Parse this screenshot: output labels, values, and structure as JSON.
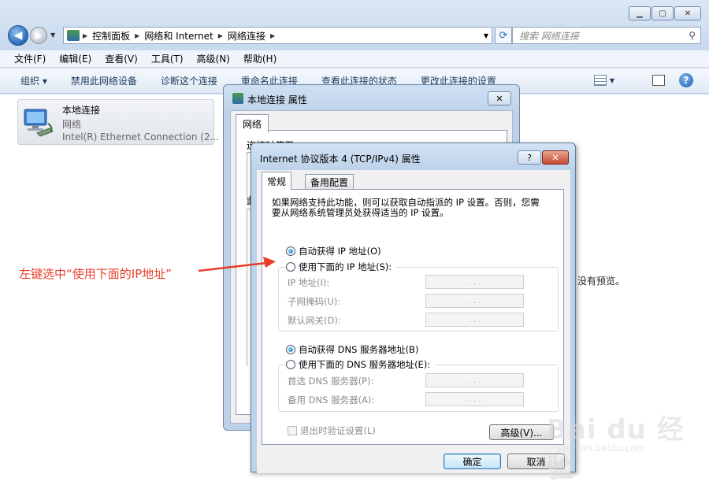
{
  "explorer": {
    "address": [
      "控制面板",
      "网络和 Internet",
      "网络连接"
    ],
    "search_placeholder": "搜索 网络连接",
    "menu": [
      "文件(F)",
      "编辑(E)",
      "查看(V)",
      "工具(T)",
      "高级(N)",
      "帮助(H)"
    ],
    "toolbar": [
      "组织 ▾",
      "禁用此网络设备",
      "诊断这个连接",
      "重命名此连接",
      "查看此连接的状态",
      "更改此连接的设置"
    ],
    "connection": {
      "name": "本地连接",
      "network": "网络",
      "device": "Intel(R) Ethernet Connection (2..."
    },
    "preview_text": "没有预览。"
  },
  "properties_dialog": {
    "title": "本地连接 属性",
    "tab": "网络",
    "text_fragment": "连接时使用:",
    "fragment2": "此"
  },
  "ipv4_dialog": {
    "title": "Internet 协议版本 4 (TCP/IPv4) 属性",
    "help_label": "?",
    "close_label": "✕",
    "tabs": [
      "常规",
      "备用配置"
    ],
    "description": "如果网络支持此功能，则可以获取自动指派的 IP 设置。否则，您需要从网络系统管理员处获得适当的 IP 设置。",
    "ip_auto": "自动获得 IP 地址(O)",
    "ip_manual": "使用下面的 IP 地址(S):",
    "ip_address_label": "IP 地址(I):",
    "subnet_label": "子网掩码(U):",
    "gateway_label": "默认网关(D):",
    "dns_auto": "自动获得 DNS 服务器地址(B)",
    "dns_manual": "使用下面的 DNS 服务器地址(E):",
    "dns_pref_label": "首选 DNS 服务器(P):",
    "dns_alt_label": "备用 DNS 服务器(A):",
    "validate_label": "退出时验证设置(L)",
    "advanced_label": "高级(V)...",
    "ok_label": "确定",
    "cancel_label": "取消",
    "ip_dots": ". . ."
  },
  "annotation": "左键选中“使用下面的IP地址”",
  "watermark": {
    "brand": "Bai du 经验",
    "url": "jingyan.baidu.com"
  },
  "colors": {
    "annotation": "#e83c28",
    "title_bar": "#c9daee"
  }
}
